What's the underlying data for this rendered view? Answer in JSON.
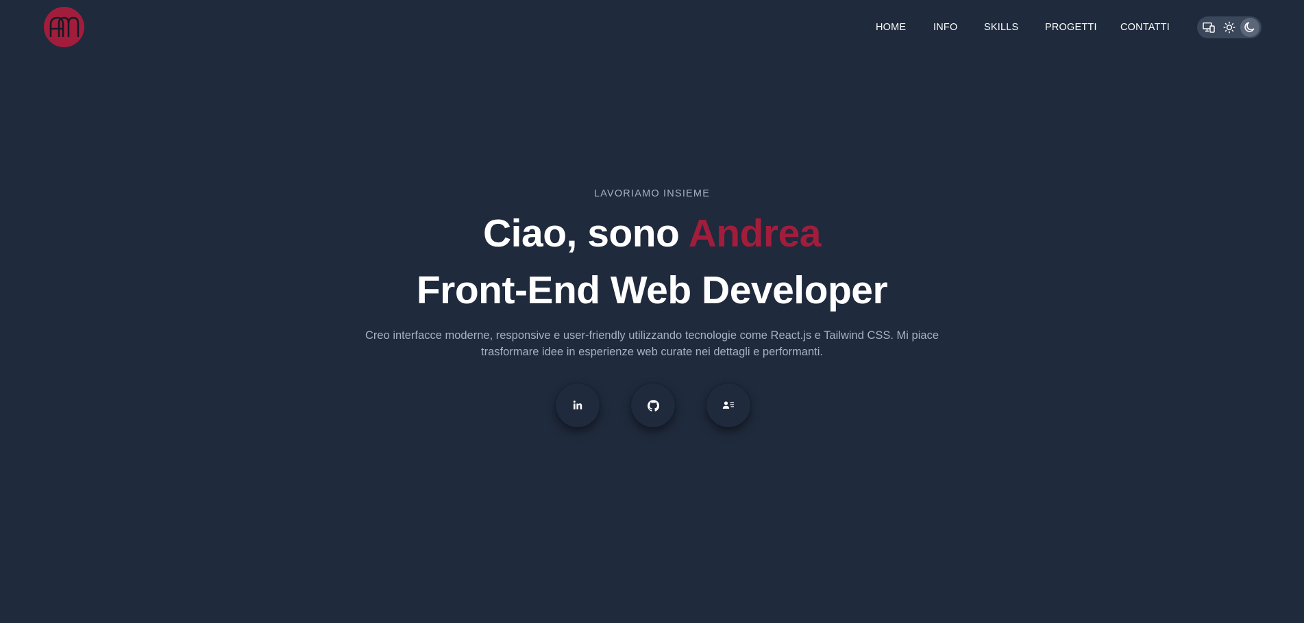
{
  "header": {
    "logo_letters": "AM",
    "nav": [
      {
        "label": "HOME"
      },
      {
        "label": "INFO"
      },
      {
        "label": "SKILLS"
      },
      {
        "label": "PROGETTI"
      },
      {
        "label": "CONTATTI"
      }
    ],
    "theme_toggle": {
      "options": [
        "system-icon",
        "sun-icon",
        "moon-icon"
      ],
      "selected": "moon-icon"
    }
  },
  "hero": {
    "eyebrow": "LAVORIAMO INSIEME",
    "greeting": "Ciao, sono ",
    "name": "Andrea",
    "role": "Front-End Web Developer",
    "description": "Creo interfacce moderne, responsive e user-friendly utilizzando tecnologie come React.js e Tailwind CSS. Mi piace trasformare idee in esperienze web curate nei dettagli e performanti.",
    "socials": [
      {
        "icon": "linkedin-icon"
      },
      {
        "icon": "github-icon"
      },
      {
        "icon": "contact-card-icon"
      }
    ]
  },
  "colors": {
    "background": "#1f2a3c",
    "accent": "#a21d3c",
    "muted_text": "#a7b1c2",
    "toggle_bg": "#3a465a"
  }
}
